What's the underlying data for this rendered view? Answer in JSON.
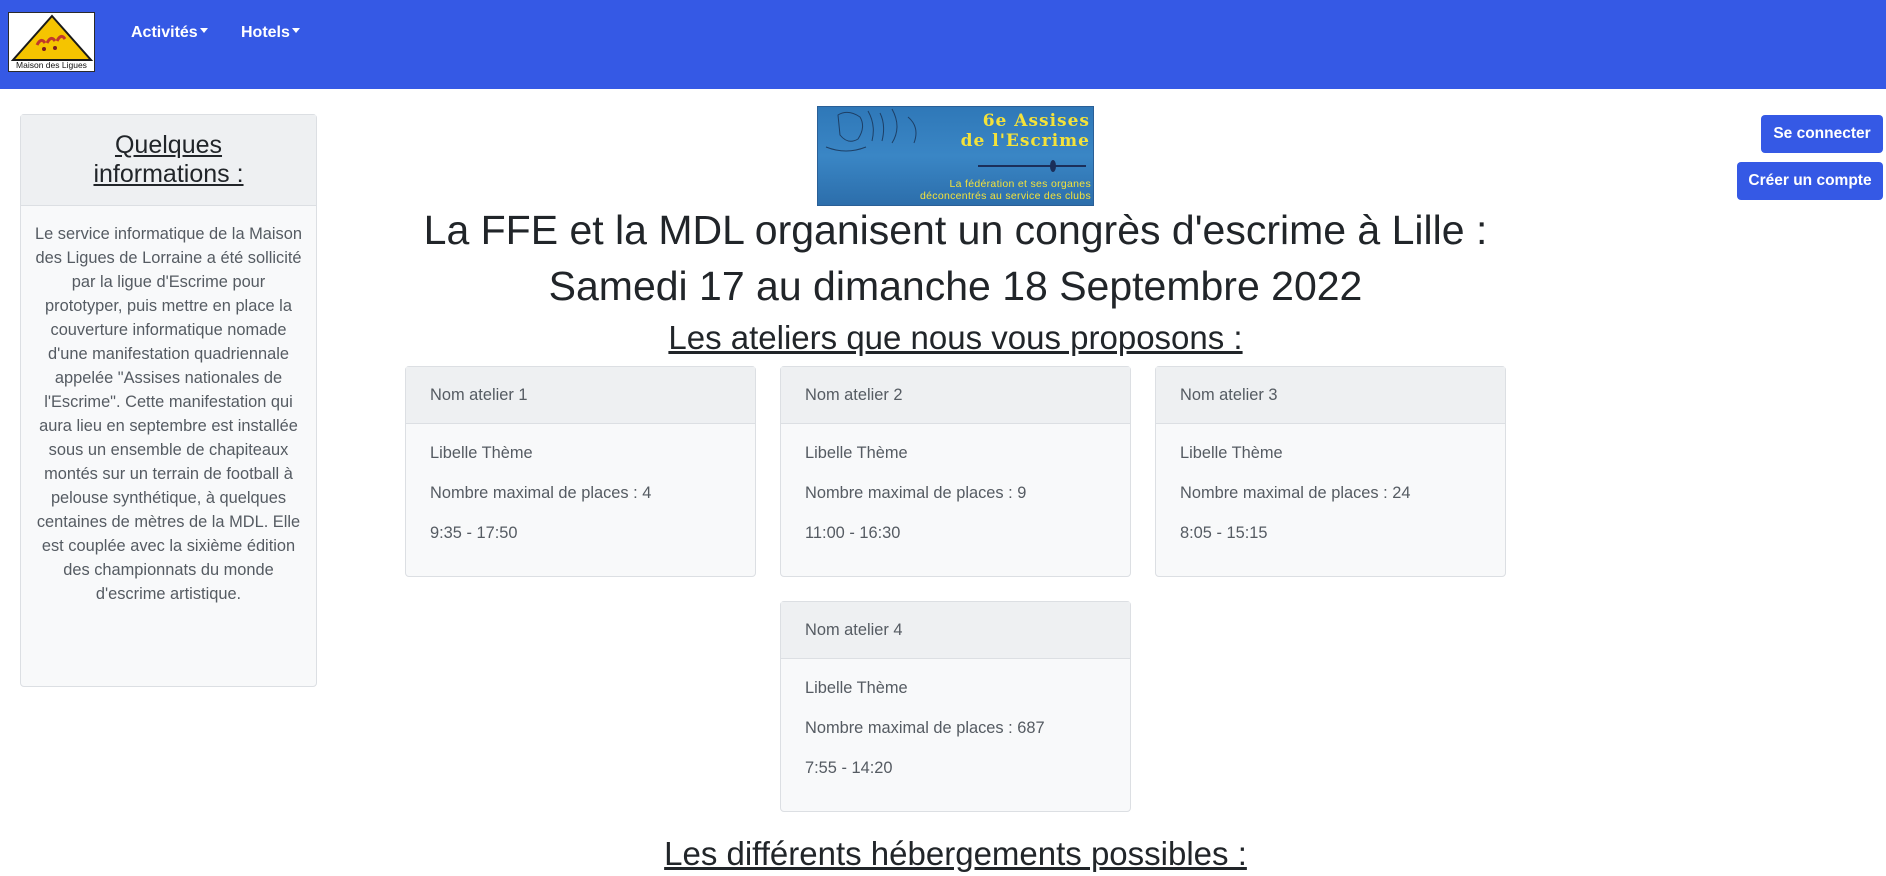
{
  "navbar": {
    "logo_text": "Maison des Ligues",
    "items": [
      {
        "label": "Activités"
      },
      {
        "label": "Hotels"
      }
    ]
  },
  "sidebar": {
    "title": "Quelques informations :",
    "body": "Le service informatique de la Maison des Ligues de Lorraine a été sollicité par la ligue d'Escrime pour prototyper, puis mettre en place la couverture informatique nomade d'une manifestation quadriennale appelée \"Assises nationales de l'Escrime\". Cette manifestation qui aura lieu en septembre est installée sous un ensemble de chapiteaux montés sur un terrain de football à pelouse synthétique, à quelques centaines de mètres de la MDL. Elle est couplée avec la sixième édition des championnats du monde d'escrime artistique."
  },
  "banner": {
    "line1": "6e Assises",
    "line2": "de l'Escrime",
    "line3": "La fédération et ses organes",
    "line4": "déconcentrés au service des clubs"
  },
  "main": {
    "headline1": "La FFE et la MDL organisent un congrès d'escrime à Lille :",
    "headline2": "Samedi 17 au dimanche 18 Septembre 2022",
    "ateliers_title": "Les ateliers que nous vous proposons :",
    "hebergements_title": "Les différents hébergements possibles :",
    "ateliers": [
      {
        "name": "Nom atelier 1",
        "theme": "Libelle Thème",
        "places": "Nombre maximal de places : 4",
        "hours": "9:35 - 17:50"
      },
      {
        "name": "Nom atelier 2",
        "theme": "Libelle Thème",
        "places": "Nombre maximal de places : 9",
        "hours": "11:00 - 16:30"
      },
      {
        "name": "Nom atelier 3",
        "theme": "Libelle Thème",
        "places": "Nombre maximal de places : 24",
        "hours": "8:05 - 15:15"
      },
      {
        "name": "Nom atelier 4",
        "theme": "Libelle Thème",
        "places": "Nombre maximal de places : 687",
        "hours": "7:55 - 14:20"
      }
    ]
  },
  "auth": {
    "login_label": "Se connecter",
    "register_label": "Créer un compte"
  },
  "colors": {
    "primary": "#3559e5",
    "banner_text": "#f4e23a"
  }
}
